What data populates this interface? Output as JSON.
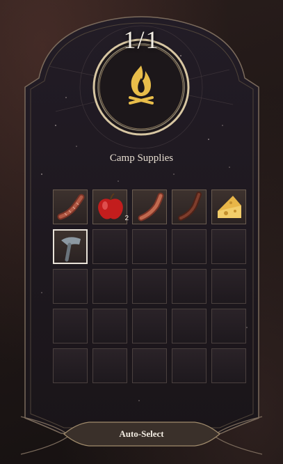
{
  "panel": {
    "counter": "1/1",
    "title": "Camp Supplies",
    "icon": "campfire-icon",
    "accent_color": "#d9b45a"
  },
  "slots": [
    {
      "item": "sausage-icon",
      "count": ""
    },
    {
      "item": "red-apple-icon",
      "count": "2"
    },
    {
      "item": "sausage-icon",
      "count": ""
    },
    {
      "item": "dark-sausage-icon",
      "count": ""
    },
    {
      "item": "cheese-wedge-icon",
      "count": ""
    },
    {
      "item": "grey-hammer-icon",
      "count": "",
      "selected": true
    }
  ],
  "empty_slot_count": 19,
  "footer": {
    "auto_select_label": "Auto-Select"
  }
}
